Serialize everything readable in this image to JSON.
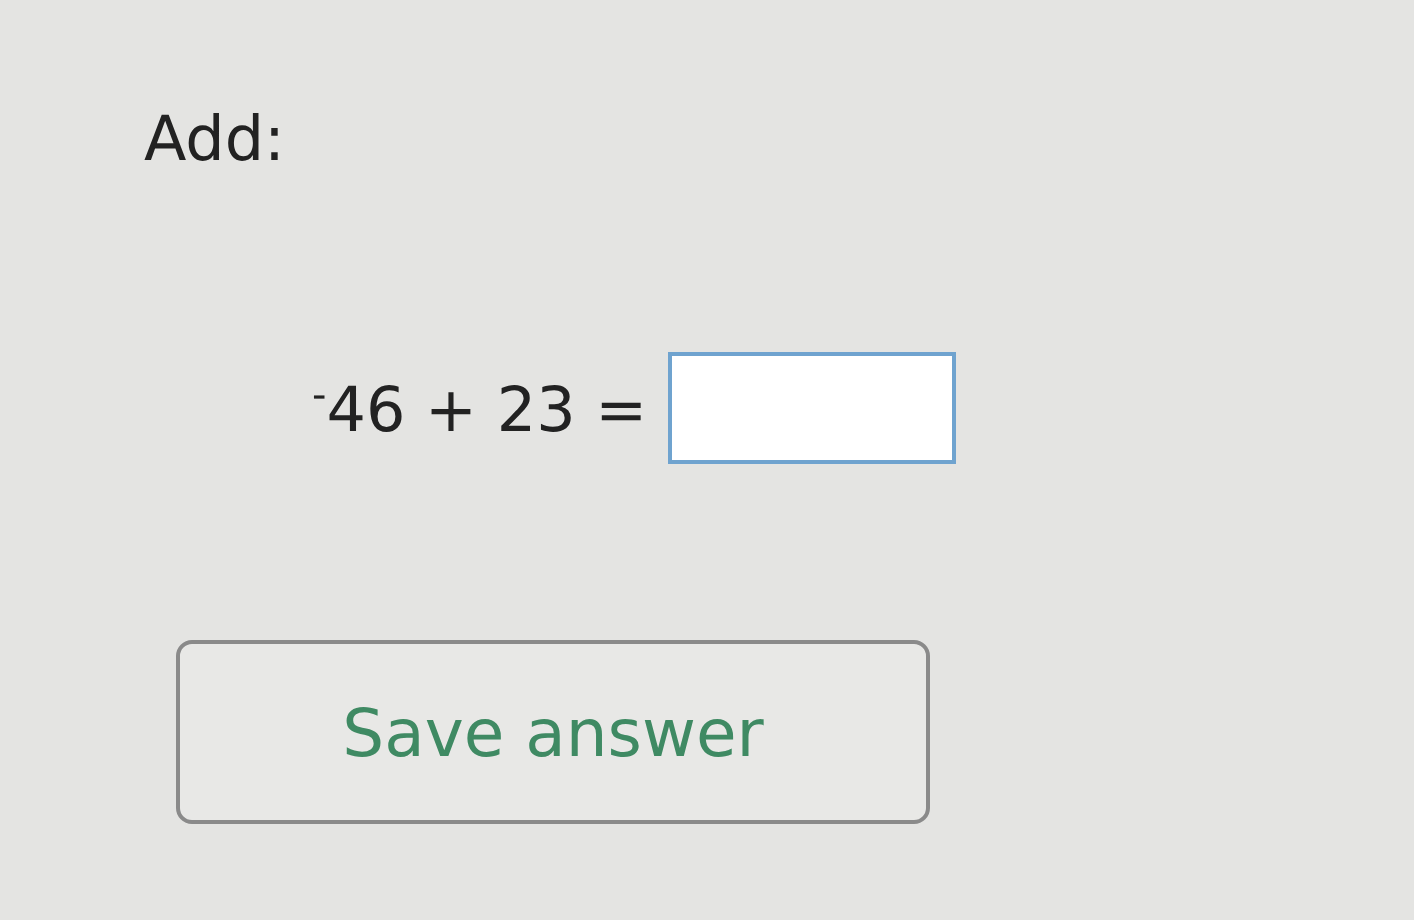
{
  "prompt": "Add:",
  "equation": "$^{-}$46 + 23 =",
  "buttons": [
    "Save answer"
  ]
}
